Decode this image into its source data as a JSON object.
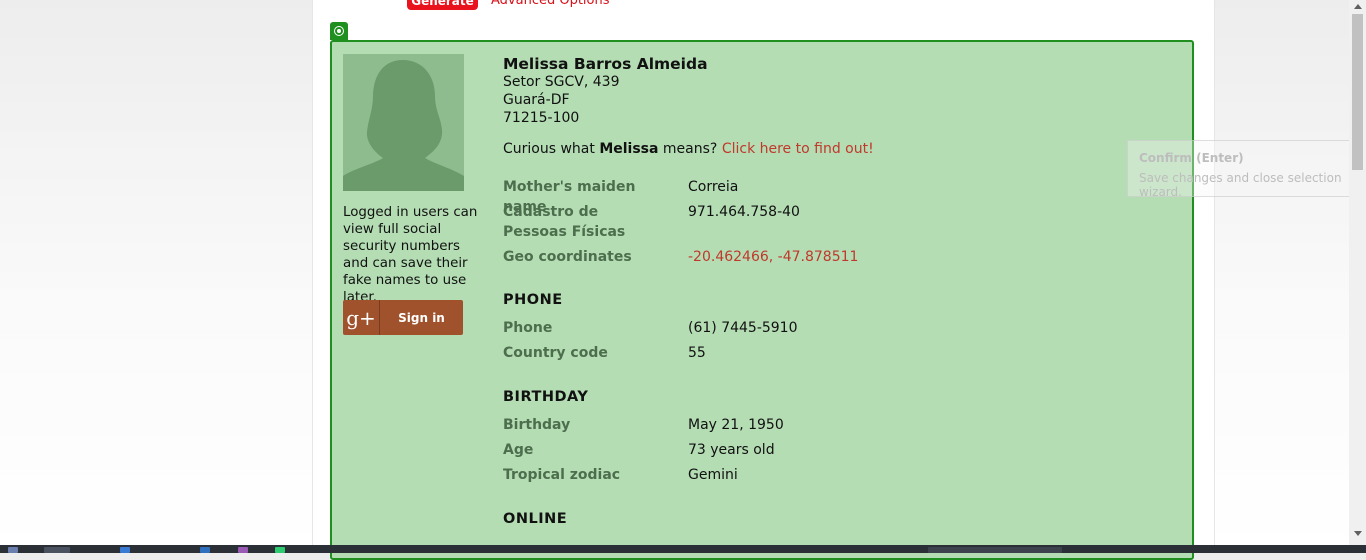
{
  "header": {
    "generate_label": "Generate",
    "advanced_label": "Advanced Options"
  },
  "profile": {
    "name": "Melissa Barros Almeida",
    "address_line1": "Setor SGCV, 439",
    "address_line2": "Guará-DF",
    "address_line3": "71215-100",
    "curious_prefix": "Curious what",
    "curious_name": "Melissa",
    "curious_suffix": "means?",
    "curious_link": "Click here to find out!"
  },
  "sidebar": {
    "logged_text": "Logged in users can view full social security numbers and can save their fake names to use later.",
    "signin_label": "Sign in",
    "gplus_glyph": "g+"
  },
  "fields": {
    "mothers_maiden_label": "Mother's maiden name",
    "mothers_maiden_value": "Correia",
    "cpf_label": "Cadastro de Pessoas Físicas",
    "cpf_value": "971.464.758-40",
    "geo_label": "Geo coordinates",
    "geo_value": "-20.462466, -47.878511"
  },
  "phone": {
    "heading": "PHONE",
    "phone_label": "Phone",
    "phone_value": "(61) 7445-5910",
    "country_label": "Country code",
    "country_value": "55"
  },
  "birthday": {
    "heading": "BIRTHDAY",
    "birthday_label": "Birthday",
    "birthday_value": "May 21, 1950",
    "age_label": "Age",
    "age_value": "73 years old",
    "zodiac_label": "Tropical zodiac",
    "zodiac_value": "Gemini"
  },
  "online": {
    "heading": "ONLINE"
  },
  "tooltip": {
    "title": "Confirm (Enter)",
    "body": "Save changes and close selection wizard."
  },
  "colors": {
    "accent_red": "#e8131c",
    "highlight_green": "#b4ddb4",
    "highlight_border": "#1f8f1f",
    "link_red": "#c0392b"
  }
}
